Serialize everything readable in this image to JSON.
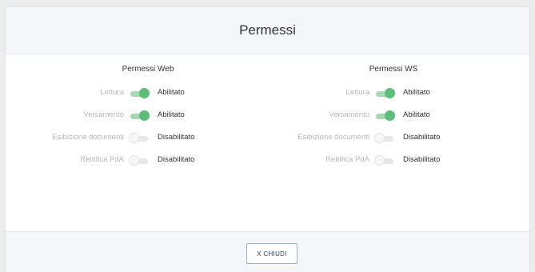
{
  "modal": {
    "title": "Permessi",
    "close_label": "X CHIUDI"
  },
  "web": {
    "title": "Permessi Web",
    "rows": [
      {
        "label": "Lettura",
        "state": "Abilitato",
        "enabled": true
      },
      {
        "label": "Versamento",
        "state": "Abilitato",
        "enabled": true
      },
      {
        "label": "Esibizione documenti",
        "state": "Disabilitato",
        "enabled": false
      },
      {
        "label": "Rettifica PdA",
        "state": "Disabilitato",
        "enabled": false
      }
    ]
  },
  "ws": {
    "title": "Permessi WS",
    "rows": [
      {
        "label": "Lettura",
        "state": "Abilitato",
        "enabled": true
      },
      {
        "label": "Versamento",
        "state": "Abilitato",
        "enabled": true
      },
      {
        "label": "Esibizione documenti",
        "state": "Disabilitato",
        "enabled": false
      },
      {
        "label": "Rettifica PdA",
        "state": "Disabilitato",
        "enabled": false
      }
    ]
  },
  "colors": {
    "toggle_on": "#5cbc7a",
    "toggle_off": "#f7f7f7",
    "button_text": "#2a4a6b"
  }
}
